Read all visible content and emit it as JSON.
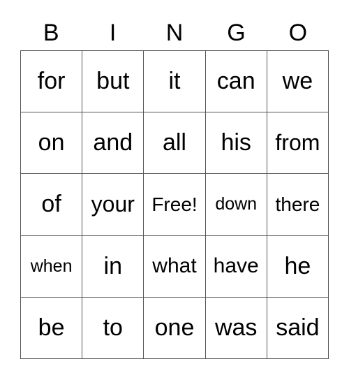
{
  "header": [
    "B",
    "I",
    "N",
    "G",
    "O"
  ],
  "rows": [
    [
      "for",
      "but",
      "it",
      "can",
      "we"
    ],
    [
      "on",
      "and",
      "all",
      "his",
      "from"
    ],
    [
      "of",
      "your",
      "Free!",
      "down",
      "there"
    ],
    [
      "when",
      "in",
      "what",
      "have",
      "he"
    ],
    [
      "be",
      "to",
      "one",
      "was",
      "said"
    ]
  ]
}
